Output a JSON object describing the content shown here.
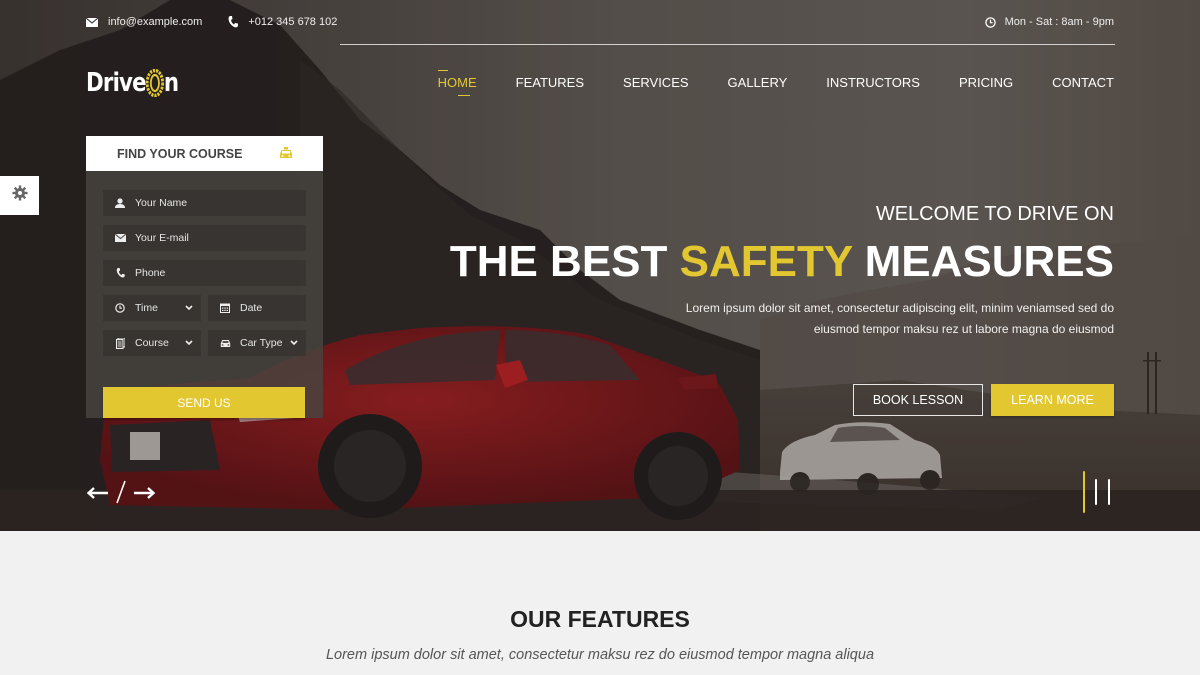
{
  "topbar": {
    "email": "info@example.com",
    "phone": "+012 345 678 102",
    "hours": "Mon - Sat : 8am - 9pm"
  },
  "logo": {
    "text_part1": "Drive",
    "text_part2": "n"
  },
  "nav": {
    "items": [
      {
        "label": "HOME",
        "active": true
      },
      {
        "label": "FEATURES",
        "active": false
      },
      {
        "label": "SERVICES",
        "active": false
      },
      {
        "label": "GALLERY",
        "active": false
      },
      {
        "label": "INSTRUCTORS",
        "active": false
      },
      {
        "label": "PRICING",
        "active": false
      },
      {
        "label": "CONTACT",
        "active": false
      }
    ]
  },
  "course_form": {
    "title": "FIND YOUR COURSE",
    "fields": {
      "name": "Your Name",
      "email": "Your E-mail",
      "phone": "Phone",
      "time": "Time",
      "date": "Date",
      "course": "Course",
      "car_type": "Car Type"
    },
    "submit": "SEND US"
  },
  "hero": {
    "welcome": "WELCOME TO DRIVE ON",
    "headline_pre": "THE BEST ",
    "headline_highlight": "SAFETY",
    "headline_post": " MEASURES",
    "desc_line1": "Lorem ipsum dolor sit amet, consectetur adipiscing elit, minim veniamsed sed do",
    "desc_line2": "eiusmod tempor maksu rez ut labore magna do eiusmod",
    "btn_book": "BOOK LESSON",
    "btn_learn": "LEARN MORE",
    "slide_separator": "/"
  },
  "slider": {
    "total_slides": 3,
    "active_slide": 1
  },
  "features": {
    "title": "OUR FEATURES",
    "subtitle": "Lorem ipsum dolor sit amet, consectetur maksu rez do eiusmod tempor magna aliqua"
  },
  "colors": {
    "accent": "#e3c731",
    "hero_overlay": "#4a4540",
    "section_bg": "#f1f1f1"
  }
}
